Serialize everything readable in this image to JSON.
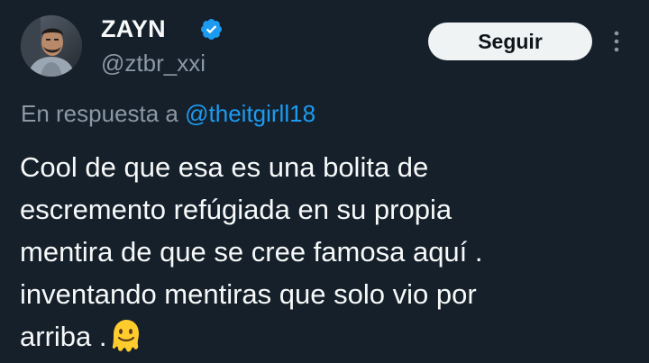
{
  "author": {
    "display_name": "ZAYN",
    "handle": "@ztbr_xxi",
    "verified_icon": "verified-badge-icon",
    "avatar_icon": "profile-photo"
  },
  "actions": {
    "follow_label": "Seguir",
    "more_icon": "more-vertical-icon"
  },
  "reply": {
    "prefix": "En respuesta a",
    "mention": "@theitgirll18"
  },
  "tweet": {
    "lines": [
      "Cool de que esa es una bolita de",
      "escremento refúgiada en su propia",
      "mentira de que se cree famosa aquí .",
      "inventando mentiras que solo vio por",
      "arriba ."
    ],
    "emoji_icon": "melting-face-emoji"
  },
  "colors": {
    "background": "#15202b",
    "text_primary": "#f7f9f9",
    "text_secondary": "#8b98a5",
    "link": "#1d9bf0",
    "button_bg": "#eff3f4",
    "button_text": "#0f1419"
  }
}
